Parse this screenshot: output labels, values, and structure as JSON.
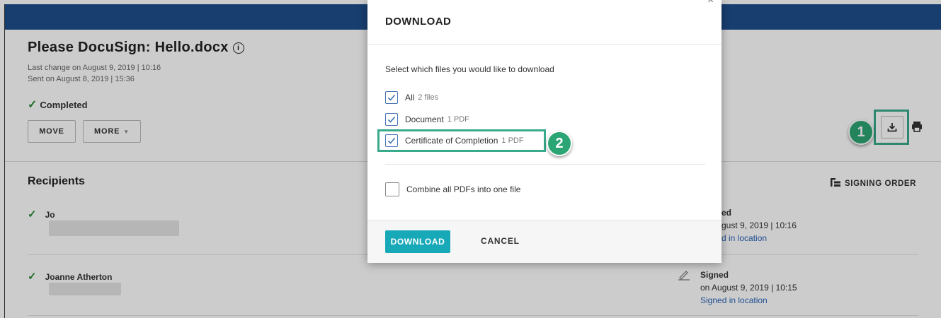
{
  "envelope": {
    "title": "Please DocuSign: Hello.docx",
    "info_icon": "i",
    "last_change": "Last change on August 9, 2019 | 10:16",
    "sent_on": "Sent on August 8, 2019 | 15:36",
    "status": "Completed",
    "move_label": "MOVE",
    "more_label": "MORE",
    "more_caret": "▼"
  },
  "recipients": {
    "heading": "Recipients",
    "signing_order_label": "SIGNING ORDER",
    "items": [
      {
        "name": "Jo",
        "status_partial": "ed",
        "date_partial": "gust 9, 2019 | 10:16",
        "link_partial": "d in location"
      },
      {
        "name": "Joanne Atherton",
        "status": "Signed",
        "date": "on August 9, 2019 | 10:15",
        "link": "Signed in location"
      }
    ]
  },
  "annotations": {
    "badge1": "1",
    "badge2": "2",
    "highlight_color": "#3aaa8c",
    "badge_color": "#2ca574"
  },
  "modal": {
    "title": "DOWNLOAD",
    "close": "×",
    "prompt": "Select which files you would like to download",
    "options": [
      {
        "label": "All",
        "sub": "2 files",
        "checked": true
      },
      {
        "label": "Document",
        "sub": "1 PDF",
        "checked": true
      },
      {
        "label": "Certificate of Completion",
        "sub": "1 PDF",
        "checked": true
      }
    ],
    "combine_label": "Combine all PDFs into one file",
    "combine_checked": false,
    "download_label": "DOWNLOAD",
    "cancel_label": "CANCEL"
  },
  "colors": {
    "topbar": "#1e4e8c",
    "primary_button": "#18a9b8",
    "checkmark_green": "#2e8b3a",
    "link": "#2a64b8"
  },
  "icons": {
    "download": "download-icon",
    "print": "print-icon",
    "signing_order": "signing-order-icon",
    "pen": "pen-icon"
  }
}
